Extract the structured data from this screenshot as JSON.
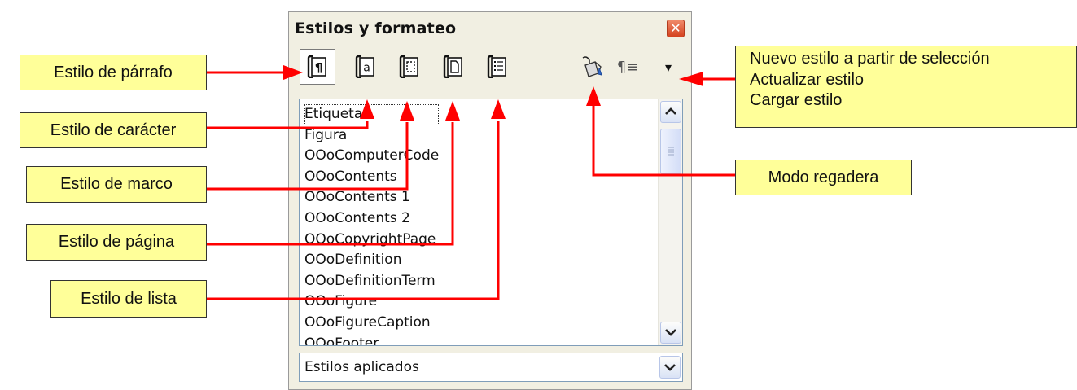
{
  "window": {
    "title": "Estilos y formateo",
    "close_label": "✕",
    "toolbar": {
      "buttons": [
        {
          "name": "paragraph-style-icon",
          "glyph": "¶"
        },
        {
          "name": "character-style-icon",
          "glyph": "a"
        },
        {
          "name": "frame-style-icon"
        },
        {
          "name": "page-style-icon"
        },
        {
          "name": "list-style-icon"
        },
        {
          "name": "fill-format-mode-icon"
        },
        {
          "name": "new-style-from-selection-icon",
          "glyph": "¶≡"
        },
        {
          "name": "dropdown-arrow-icon",
          "glyph": "▾"
        }
      ]
    },
    "styles_list": [
      "Etiqueta",
      "Figura",
      "OOoComputerCode",
      "OOoContents",
      "OOoContents 1",
      "OOoContents 2",
      "OOoCopyrightPage",
      "OOoDefinition",
      "OOoDefinitionTerm",
      "OOoFigure",
      "OOoFigureCaption",
      "OOoFooter"
    ],
    "filter_value": "Estilos aplicados"
  },
  "callouts": {
    "paragraph": "Estilo de párrafo",
    "character": "Estilo de carácter",
    "frame": "Estilo de marco",
    "page": "Estilo de página",
    "list": "Estilo de lista",
    "menu": [
      "Nuevo estilo a partir de selección",
      "Actualizar estilo",
      "Cargar estilo"
    ],
    "fill_mode": "Modo regadera"
  },
  "colors": {
    "callout_fill": "#ffff99",
    "arrow": "#ff0000",
    "panel": "#f1efe2",
    "close_button": "#d4421f"
  }
}
